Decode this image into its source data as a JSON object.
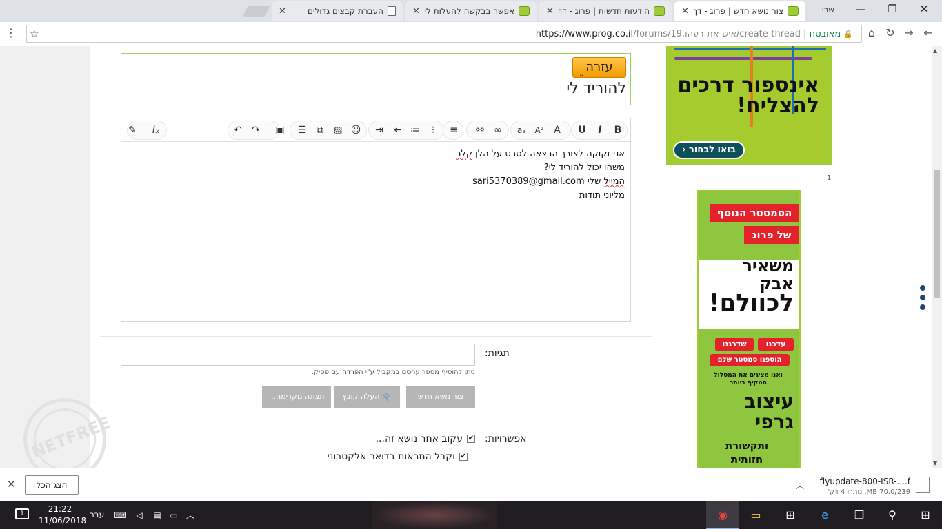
{
  "browser": {
    "profile": "שרי",
    "tabs": [
      {
        "title": "צור נושא חדש | פרוג - דף",
        "favicon": "prog-icon",
        "active": true
      },
      {
        "title": "הודעות חדשות | פרוג - דף",
        "favicon": "prog-icon",
        "active": false
      },
      {
        "title": "אפשר בבקשה להעלות לי",
        "favicon": "prog-icon",
        "active": false
      },
      {
        "title": "העברת קבצים גדולים",
        "favicon": "doc-icon",
        "active": false
      }
    ],
    "secure_label": "מאובטח",
    "url_prefix": "https://www.prog.co.il",
    "url_path": "/forums/19.איש-את-רעהו/create-thread"
  },
  "form": {
    "help_button": "עזרה",
    "title_value": "להוריד לי",
    "body_lines": [
      {
        "before": "אני זקוקה לצורך הרצאה לסרט על הלן ",
        "spell": "קלר",
        "after": ""
      },
      {
        "before": "משהו יכול להוריד לי?",
        "spell": "",
        "after": ""
      },
      {
        "before": "",
        "spell": "המייל",
        "after": " שלי sari5370389@gmail.com"
      },
      {
        "before": "מליוני תודות",
        "spell": "",
        "after": ""
      }
    ],
    "tags_label": "תגיות:",
    "tags_value": "",
    "tags_hint": "ניתן להוסיף מספר ערכים במקביל ע\"י הפרדה עם פסיק.",
    "create_button": "צור נושא חדש",
    "upload_button": "העלה קובץ",
    "preview_button": "תצוגה מקדימה...",
    "options_label": "אפשרויות:",
    "option_watch": "עקוב אחר נושא זה...",
    "option_email": "וקבל התראות בדואר אלקטרוני"
  },
  "ads": {
    "ad1_text": "אינספור דרכים להצליח!",
    "ad1_button": "בואו לבחור",
    "ad_counter": "1",
    "ad2_banner1": "הסמסטר הנוסף",
    "ad2_banner2": "של פרוג",
    "ad2_big1": "משאיר",
    "ad2_big2": "אבק",
    "ad2_big3": "לכוולם!",
    "ad2_tag1": "עדכנו",
    "ad2_tag2": "שדרגנו",
    "ad2_tag3": "הוספנו סמסטר שלם",
    "ad2_small": "ואנו מציגים את המסלול המקיף ביותר",
    "ad2_course1": "עיצוב",
    "ad2_course2": "גרפי",
    "ad2_course3": "ותקשורת",
    "ad2_course4": "חזותית"
  },
  "watermark": "NETFREE",
  "download": {
    "file": "flyupdate-800-ISR-....f",
    "status": "70.0/239 MB, נותרו 4 דק'",
    "show_all": "הצג הכל"
  },
  "taskbar": {
    "time": "21:22",
    "date": "11/06/2018",
    "lang": "עבר",
    "notif_count": "1"
  }
}
